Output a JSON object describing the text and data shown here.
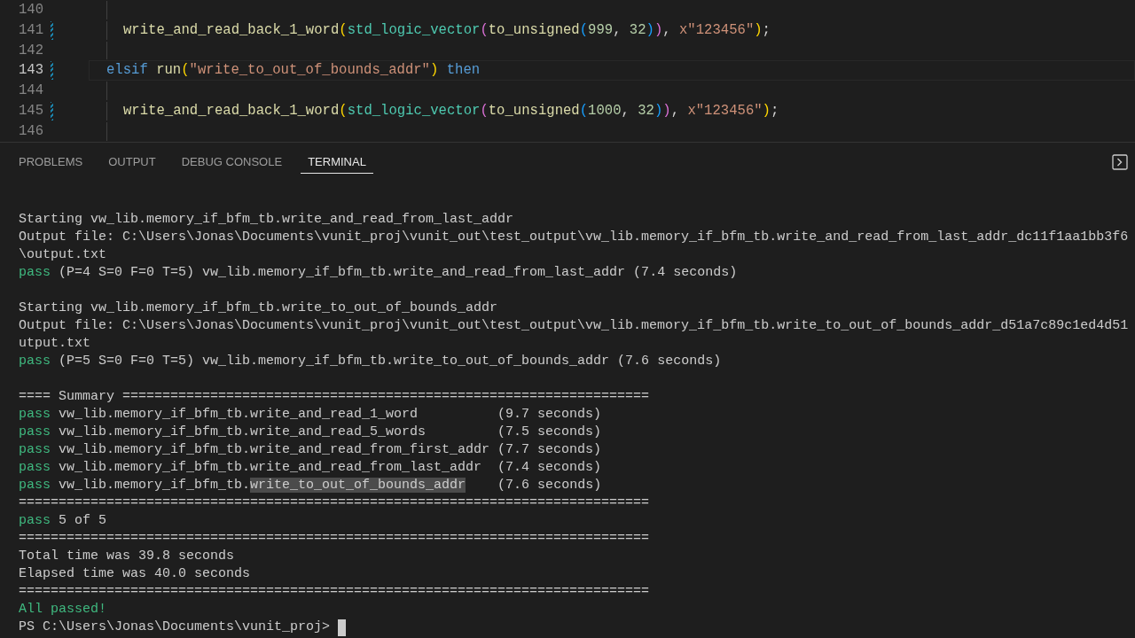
{
  "editor": {
    "lines": [
      {
        "number": "140",
        "kind": "blank",
        "modified": false,
        "current": false
      },
      {
        "number": "141",
        "kind": "statement",
        "modified": true,
        "current": false,
        "tokens": [
          {
            "kind": "fn",
            "text": "write_and_read_back_1_word"
          },
          {
            "kind": "bracket1",
            "text": "("
          },
          {
            "kind": "type",
            "text": "std_logic_vector"
          },
          {
            "kind": "bracket2",
            "text": "("
          },
          {
            "kind": "fn",
            "text": "to_unsigned"
          },
          {
            "kind": "bracket3",
            "text": "("
          },
          {
            "kind": "num",
            "text": "999"
          },
          {
            "kind": "plain",
            "text": ", "
          },
          {
            "kind": "num",
            "text": "32"
          },
          {
            "kind": "bracket3",
            "text": ")"
          },
          {
            "kind": "bracket2",
            "text": ")"
          },
          {
            "kind": "plain",
            "text": ", "
          },
          {
            "kind": "str",
            "text": "x\"123456\""
          },
          {
            "kind": "bracket1",
            "text": ")"
          },
          {
            "kind": "plain",
            "text": ";"
          }
        ]
      },
      {
        "number": "142",
        "kind": "blank",
        "modified": false,
        "current": false
      },
      {
        "number": "143",
        "kind": "branch",
        "modified": true,
        "current": true,
        "tokens": [
          {
            "kind": "kw",
            "text": "elsif "
          },
          {
            "kind": "fn",
            "text": "run"
          },
          {
            "kind": "bracket1",
            "text": "("
          },
          {
            "kind": "str",
            "text": "\"write_to_out_of_bounds_addr\""
          },
          {
            "kind": "bracket1",
            "text": ") "
          },
          {
            "kind": "kw",
            "text": "then"
          }
        ]
      },
      {
        "number": "144",
        "kind": "blank",
        "modified": false,
        "current": false
      },
      {
        "number": "145",
        "kind": "statement",
        "modified": true,
        "current": false,
        "tokens": [
          {
            "kind": "fn",
            "text": "write_and_read_back_1_word"
          },
          {
            "kind": "bracket1",
            "text": "("
          },
          {
            "kind": "type",
            "text": "std_logic_vector"
          },
          {
            "kind": "bracket2",
            "text": "("
          },
          {
            "kind": "fn",
            "text": "to_unsigned"
          },
          {
            "kind": "bracket3",
            "text": "("
          },
          {
            "kind": "num",
            "text": "1000"
          },
          {
            "kind": "plain",
            "text": ", "
          },
          {
            "kind": "num",
            "text": "32"
          },
          {
            "kind": "bracket3",
            "text": ")"
          },
          {
            "kind": "bracket2",
            "text": ")"
          },
          {
            "kind": "plain",
            "text": ", "
          },
          {
            "kind": "str",
            "text": "x\"123456\""
          },
          {
            "kind": "bracket1",
            "text": ")"
          },
          {
            "kind": "plain",
            "text": ";"
          }
        ]
      },
      {
        "number": "146",
        "kind": "blank",
        "modified": false,
        "current": false
      }
    ]
  },
  "panel": {
    "tabs": [
      {
        "label": "PROBLEMS",
        "selected": false
      },
      {
        "label": "OUTPUT",
        "selected": false
      },
      {
        "label": "DEBUG CONSOLE",
        "selected": false
      },
      {
        "label": "TERMINAL",
        "selected": true
      }
    ]
  },
  "terminal": {
    "lines": [
      {
        "kind": "output",
        "segments": [
          {
            "kind": "plain",
            "text": "Starting vw_lib.memory_if_bfm_tb.write_and_read_from_last_addr"
          }
        ]
      },
      {
        "kind": "output",
        "segments": [
          {
            "kind": "plain",
            "text": "Output file: C:\\Users\\Jonas\\Documents\\vunit_proj\\vunit_out\\test_output\\vw_lib.memory_if_bfm_tb.write_and_read_from_last_addr_dc11f1aa1bb3f6"
          }
        ]
      },
      {
        "kind": "output",
        "segments": [
          {
            "kind": "plain",
            "text": "\\output.txt"
          }
        ]
      },
      {
        "kind": "output",
        "segments": [
          {
            "kind": "pass",
            "text": "pass"
          },
          {
            "kind": "plain",
            "text": " (P=4 S=0 F=0 T=5) vw_lib.memory_if_bfm_tb.write_and_read_from_last_addr (7.4 seconds)"
          }
        ]
      },
      {
        "kind": "blank"
      },
      {
        "kind": "output",
        "segments": [
          {
            "kind": "plain",
            "text": "Starting vw_lib.memory_if_bfm_tb.write_to_out_of_bounds_addr"
          }
        ]
      },
      {
        "kind": "output",
        "segments": [
          {
            "kind": "plain",
            "text": "Output file: C:\\Users\\Jonas\\Documents\\vunit_proj\\vunit_out\\test_output\\vw_lib.memory_if_bfm_tb.write_to_out_of_bounds_addr_d51a7c89c1ed4d51"
          }
        ]
      },
      {
        "kind": "output",
        "segments": [
          {
            "kind": "plain",
            "text": "utput.txt"
          }
        ]
      },
      {
        "kind": "output",
        "segments": [
          {
            "kind": "pass",
            "text": "pass"
          },
          {
            "kind": "plain",
            "text": " (P=5 S=0 F=0 T=5) vw_lib.memory_if_bfm_tb.write_to_out_of_bounds_addr (7.6 seconds)"
          }
        ]
      },
      {
        "kind": "blank"
      },
      {
        "kind": "output",
        "segments": [
          {
            "kind": "plain",
            "text": "==== Summary =================================================================="
          }
        ]
      },
      {
        "kind": "output",
        "segments": [
          {
            "kind": "pass",
            "text": "pass"
          },
          {
            "kind": "plain",
            "text": " vw_lib.memory_if_bfm_tb.write_and_read_1_word          (9.7 seconds)"
          }
        ]
      },
      {
        "kind": "output",
        "segments": [
          {
            "kind": "pass",
            "text": "pass"
          },
          {
            "kind": "plain",
            "text": " vw_lib.memory_if_bfm_tb.write_and_read_5_words         (7.5 seconds)"
          }
        ]
      },
      {
        "kind": "output",
        "segments": [
          {
            "kind": "pass",
            "text": "pass"
          },
          {
            "kind": "plain",
            "text": " vw_lib.memory_if_bfm_tb.write_and_read_from_first_addr (7.7 seconds)"
          }
        ]
      },
      {
        "kind": "output",
        "segments": [
          {
            "kind": "pass",
            "text": "pass"
          },
          {
            "kind": "plain",
            "text": " vw_lib.memory_if_bfm_tb.write_and_read_from_last_addr  (7.4 seconds)"
          }
        ]
      },
      {
        "kind": "output",
        "segments": [
          {
            "kind": "pass",
            "text": "pass"
          },
          {
            "kind": "plain",
            "text": " vw_lib.memory_if_bfm_tb."
          },
          {
            "kind": "selection",
            "text": "write_to_out_of_bounds_addr"
          },
          {
            "kind": "plain",
            "text": "    (7.6 seconds)"
          }
        ]
      },
      {
        "kind": "output",
        "segments": [
          {
            "kind": "plain",
            "text": "==============================================================================="
          }
        ]
      },
      {
        "kind": "output",
        "segments": [
          {
            "kind": "pass",
            "text": "pass"
          },
          {
            "kind": "plain",
            "text": " 5 of 5"
          }
        ]
      },
      {
        "kind": "output",
        "segments": [
          {
            "kind": "plain",
            "text": "==============================================================================="
          }
        ]
      },
      {
        "kind": "output",
        "segments": [
          {
            "kind": "plain",
            "text": "Total time was 39.8 seconds"
          }
        ]
      },
      {
        "kind": "output",
        "segments": [
          {
            "kind": "plain",
            "text": "Elapsed time was 40.0 seconds"
          }
        ]
      },
      {
        "kind": "output",
        "segments": [
          {
            "kind": "plain",
            "text": "==============================================================================="
          }
        ]
      },
      {
        "kind": "output",
        "segments": [
          {
            "kind": "pass",
            "text": "All passed!"
          }
        ]
      }
    ],
    "prompt": {
      "text": "PS C:\\Users\\Jonas\\Documents\\vunit_proj>",
      "cursor": true
    }
  }
}
